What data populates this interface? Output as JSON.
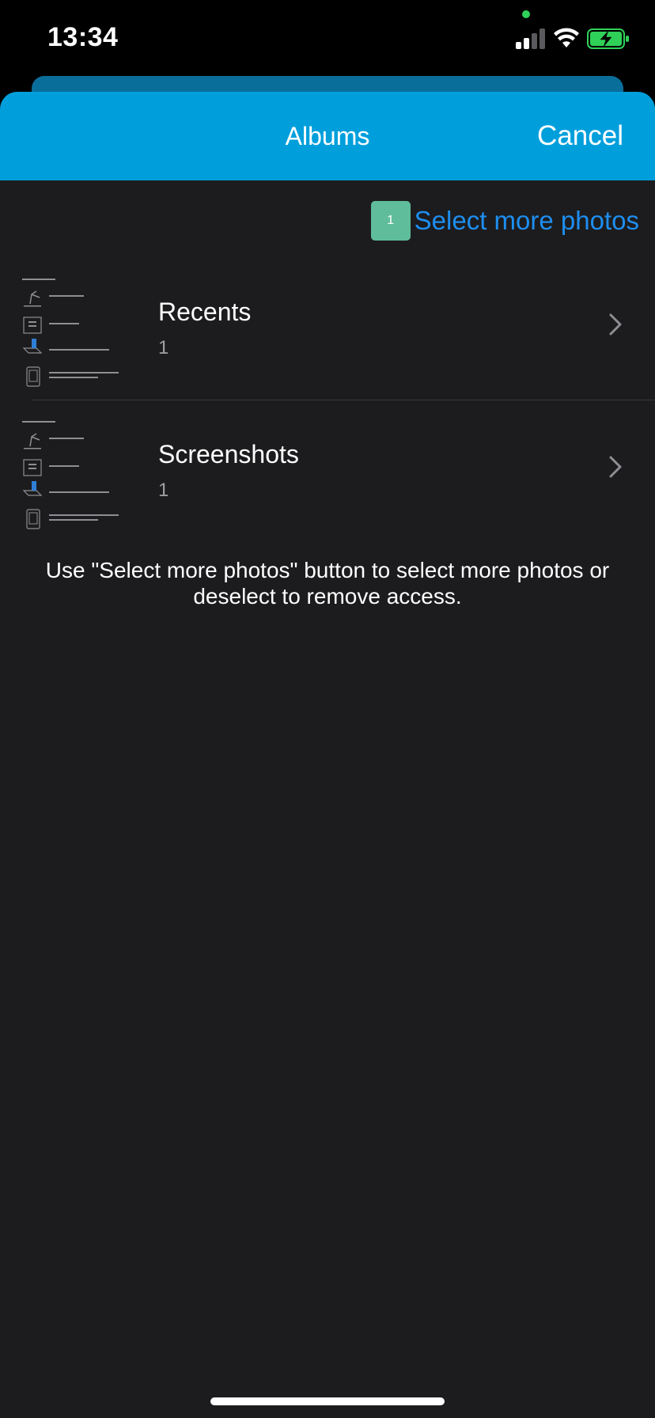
{
  "status_bar": {
    "time": "13:34",
    "icons": [
      "signal-icon",
      "wifi-icon",
      "battery-charging-icon"
    ]
  },
  "nav": {
    "title": "Albums",
    "cancel_label": "Cancel"
  },
  "select_more": {
    "count": "1",
    "label": "Select more photos"
  },
  "albums": [
    {
      "name": "Recents",
      "count": "1",
      "thumbnail": {
        "lines": [
          "Ensure good lighting",
          "Flatten the page",
          "Hold device parallel over the page",
          "Capture the entire page within the frame",
          "shown on the camera screen"
        ]
      }
    },
    {
      "name": "Screenshots",
      "count": "1",
      "thumbnail": {
        "lines": [
          "Ensure good lighting",
          "Flatten the page",
          "Hold device parallel over the page",
          "Capture the entire page within the frame",
          "shown on the camera screen"
        ]
      }
    }
  ],
  "hint": "Use \"Select more photos\" button to select more photos or deselect to remove access.",
  "colors": {
    "nav_bar": "#009fdc",
    "sheet_background": "#1c1c1e",
    "link_blue": "#1e8ef0",
    "badge_green": "#5fbd9b"
  }
}
